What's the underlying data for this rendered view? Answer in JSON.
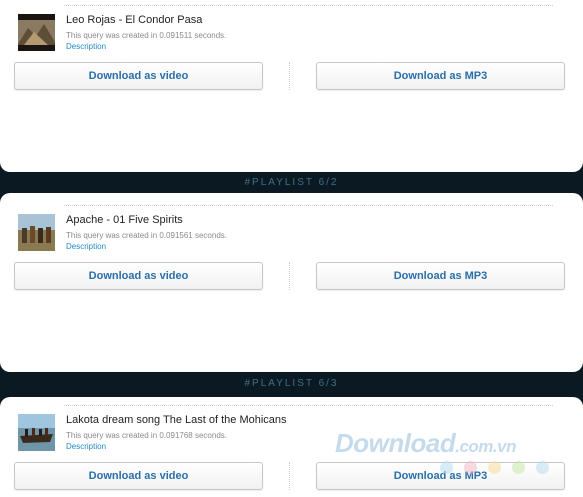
{
  "playlist": [
    {
      "title": "Leo Rojas - El Condor Pasa",
      "query_time": "This query was created in 0.091511 seconds.",
      "description": "Description",
      "video_button": "Download as video",
      "mp3_button": "Download as MP3"
    },
    {
      "title": "Apache - 01 Five Spirits",
      "query_time": "This query was created in 0.091561 seconds.",
      "description": "Description",
      "video_button": "Download as video",
      "mp3_button": "Download as MP3"
    },
    {
      "title": "Lakota dream song The Last of the Mohicans",
      "query_time": "This query was created in 0.091768 seconds.",
      "description": "Description",
      "video_button": "Download as video",
      "mp3_button": "Download as MP3"
    }
  ],
  "banners": [
    "#PLAYLIST 6/2",
    "#PLAYLIST 6/3"
  ],
  "watermark": {
    "main": "Download",
    "suffix": ".com.vn"
  },
  "colors": {
    "background": "#0b1a22",
    "banner_text": "#3f6f86",
    "button_text": "#2a6fa8",
    "link": "#1e88c8",
    "watermark_dots": [
      "#b8dcf0",
      "#f2b8c8",
      "#f6dc9a",
      "#c6e6a6",
      "#b8dcf0"
    ]
  }
}
